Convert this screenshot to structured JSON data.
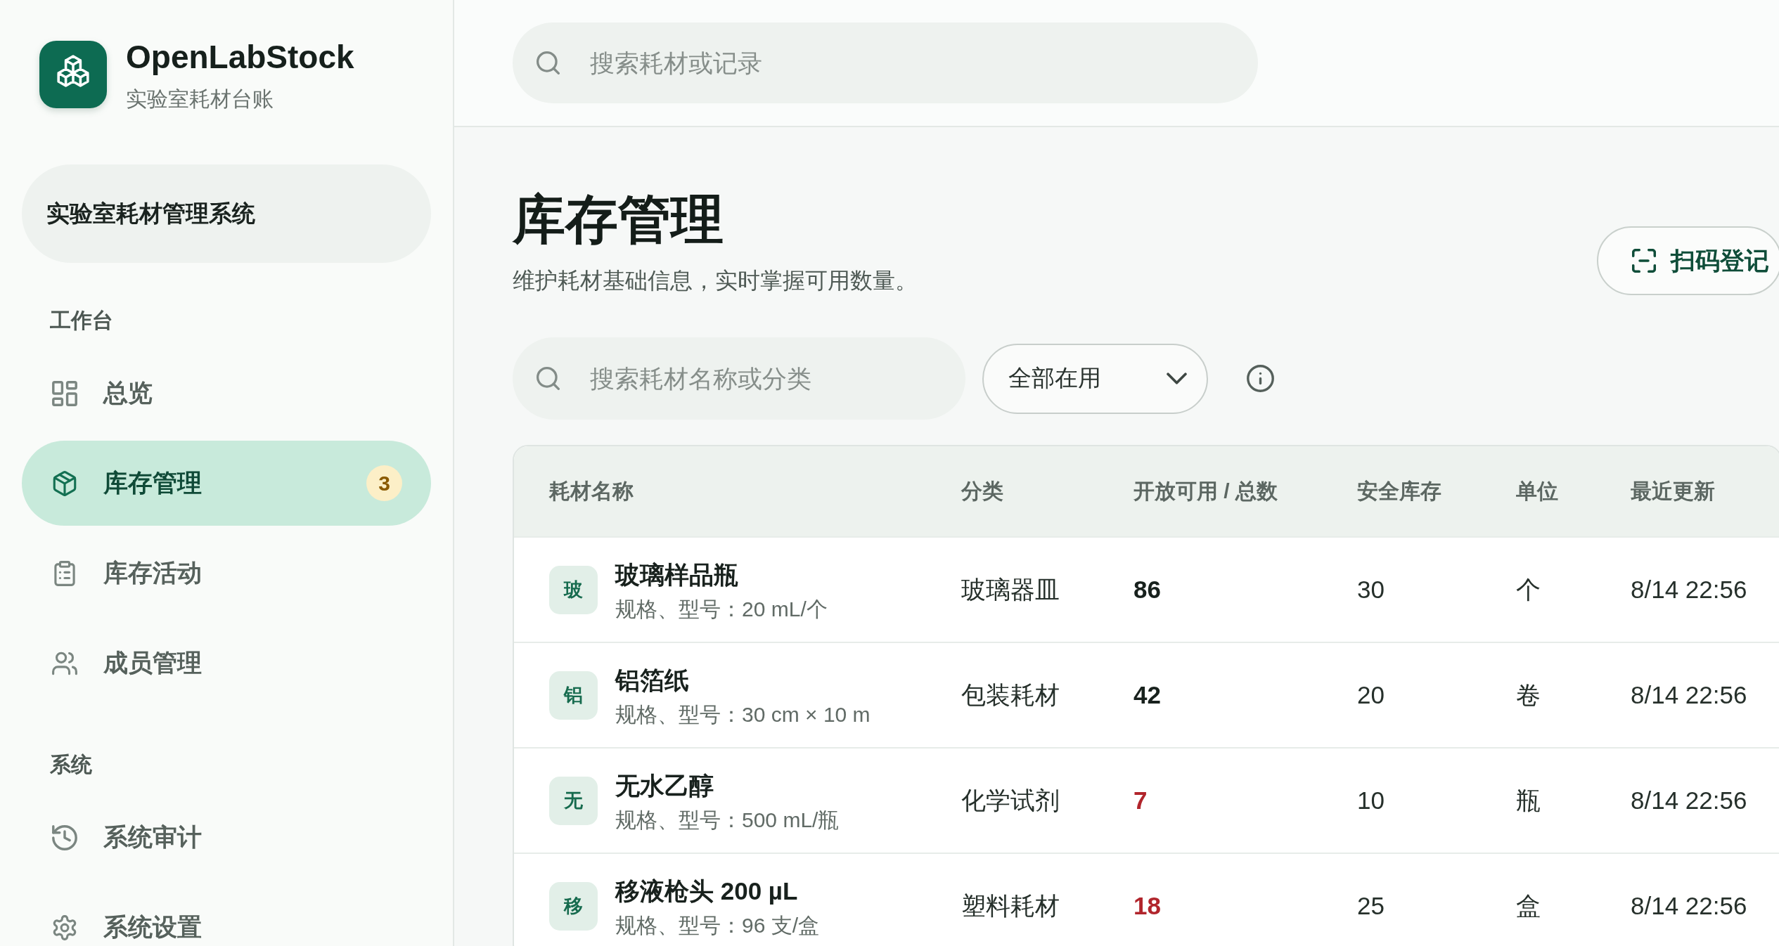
{
  "brand": {
    "name": "OpenLabStock",
    "tagline": "实验室耗材台账"
  },
  "workspace": {
    "label": "实验室耗材管理系统"
  },
  "sidebar": {
    "sections": [
      {
        "title": "工作台",
        "items": [
          {
            "label": "总览",
            "selected": false
          },
          {
            "label": "库存管理",
            "selected": true,
            "badge": "3"
          },
          {
            "label": "库存活动",
            "selected": false
          },
          {
            "label": "成员管理",
            "selected": false
          }
        ]
      },
      {
        "title": "系统",
        "items": [
          {
            "label": "系统审计",
            "selected": false
          },
          {
            "label": "系统设置",
            "selected": false
          }
        ]
      }
    ]
  },
  "top_search": {
    "placeholder": "搜索耗材或记录"
  },
  "page": {
    "title": "库存管理",
    "subtitle": "维护耗材基础信息，实时掌握可用数量。",
    "actions": [
      {
        "label": "扫码登记"
      }
    ]
  },
  "filters": {
    "search": {
      "placeholder": "搜索耗材名称或分类"
    },
    "status": {
      "value": "全部在用"
    }
  },
  "table": {
    "columns": [
      "耗材名称",
      "分类",
      "开放可用 / 总数",
      "安全库存",
      "单位",
      "最近更新"
    ],
    "rows": [
      {
        "initial": "玻",
        "name": "玻璃样品瓶",
        "spec": "规格、型号：20 mL/个",
        "category": "玻璃器皿",
        "available": "86",
        "low_stock": false,
        "safety_stock": "30",
        "unit": "个",
        "updated": "8/14 22:56"
      },
      {
        "initial": "铝",
        "name": "铝箔纸",
        "spec": "规格、型号：30 cm × 10 m",
        "category": "包装耗材",
        "available": "42",
        "low_stock": false,
        "safety_stock": "20",
        "unit": "卷",
        "updated": "8/14 22:56"
      },
      {
        "initial": "无",
        "name": "无水乙醇",
        "spec": "规格、型号：500 mL/瓶",
        "category": "化学试剂",
        "available": "7",
        "low_stock": true,
        "safety_stock": "10",
        "unit": "瓶",
        "updated": "8/14 22:56"
      },
      {
        "initial": "移",
        "name": "移液枪头 200 µL",
        "spec": "规格、型号：96 支/盒",
        "category": "塑料耗材",
        "available": "18",
        "low_stock": true,
        "safety_stock": "25",
        "unit": "盒",
        "updated": "8/14 22:56"
      }
    ]
  }
}
